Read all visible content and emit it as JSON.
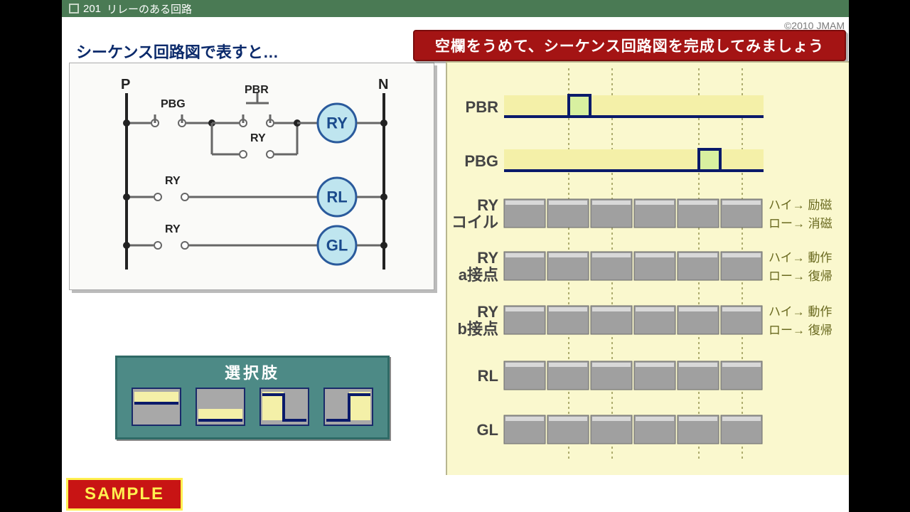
{
  "title_number": "201",
  "title_text": "リレーのある回路",
  "copyright": "©2010 JMAM",
  "left_heading": "シーケンス回路図で表すと…",
  "banner": "空欄をうめて、シーケンス回路図を完成してみましょう",
  "circuit": {
    "p": "P",
    "n": "N",
    "pbg": "PBG",
    "pbr": "PBR",
    "ry_sm1": "RY",
    "ry_sm2": "RY",
    "ry_sm3": "RY",
    "coil_ry": "RY",
    "coil_rl": "RL",
    "coil_gl": "GL"
  },
  "chart_rows": {
    "pbr": "PBR",
    "pbg": "PBG",
    "ry_coil_1": "RY",
    "ry_coil_2": "コイル",
    "ry_a_1": "RY",
    "ry_a_2": "a接点",
    "ry_b_1": "RY",
    "ry_b_2": "b接点",
    "rl": "RL",
    "gl": "GL"
  },
  "ann": {
    "hi_reiji": "ハイ→ 励磁",
    "lo_shoji": "ロー→ 消磁",
    "hi_dosa": "ハイ→ 動作",
    "lo_fukki": "ロー→ 復帰"
  },
  "choice_title": "選択肢",
  "sample": "SAMPLE",
  "chart_data": {
    "type": "table",
    "description": "Timing chart exercise with 6 time-slot columns. PBR pulses high in slot 2; PBG pulses high in slot 5; remaining rows (RY coil, RY a-contact, RY b-contact, RL, GL) are empty answer slots the learner fills from the four waveform options.",
    "columns": 6,
    "signals": {
      "PBR": [
        "low",
        "high",
        "low",
        "low",
        "low",
        "low"
      ],
      "PBG": [
        "low",
        "low",
        "low",
        "low",
        "high",
        "low"
      ],
      "RY_coil": null,
      "RY_a": null,
      "RY_b": null,
      "RL": null,
      "GL": null
    },
    "options": [
      "flat-high",
      "flat-low",
      "step-down",
      "step-up"
    ]
  }
}
